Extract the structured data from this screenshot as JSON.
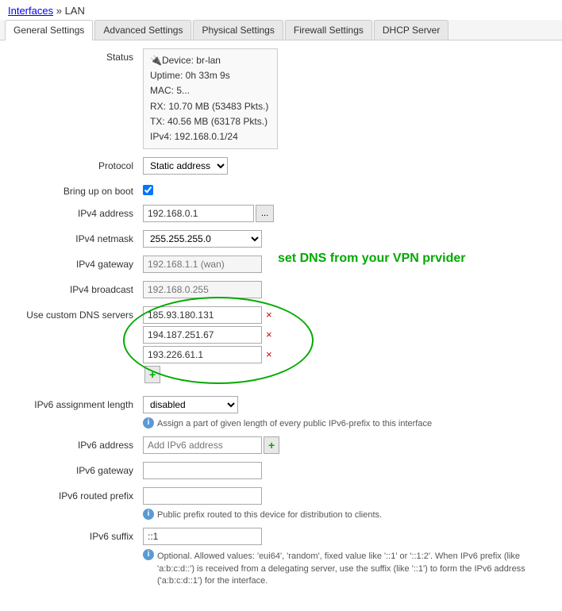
{
  "breadcrumb": {
    "parent": "Interfaces",
    "separator": " » ",
    "current": "LAN"
  },
  "tabs": [
    {
      "label": "General Settings",
      "active": true
    },
    {
      "label": "Advanced Settings",
      "active": false
    },
    {
      "label": "Physical Settings",
      "active": false
    },
    {
      "label": "Firewall Settings",
      "active": false
    },
    {
      "label": "DHCP Server",
      "active": false
    }
  ],
  "fields": {
    "status_label": "Status",
    "status_device": "Device: br-lan",
    "status_uptime": "Uptime: 0h 33m 9s",
    "status_mac": "MAC: 5...",
    "status_rx": "RX: 10.70 MB (53483 Pkts.)",
    "status_tx": "TX: 40.56 MB (63178 Pkts.)",
    "status_ipv4": "IPv4: 192.168.0.1/24",
    "protocol_label": "Protocol",
    "protocol_value": "Static address",
    "bring_up_label": "Bring up on boot",
    "ipv4_address_label": "IPv4 address",
    "ipv4_address_value": "192.168.0.1",
    "ipv4_netmask_label": "IPv4 netmask",
    "ipv4_netmask_value": "255.255.255.0",
    "ipv4_gateway_label": "IPv4 gateway",
    "ipv4_gateway_placeholder": "192.168.1.1 (wan)",
    "ipv4_broadcast_label": "IPv4 broadcast",
    "ipv4_broadcast_placeholder": "192.168.0.255",
    "custom_dns_label": "Use custom DNS servers",
    "dns1": "185.93.180.131",
    "dns2": "194.187.251.67",
    "dns3": "193.226.61.1",
    "vpn_note": "set DNS from your VPN prvider",
    "ipv6_assignment_label": "IPv6 assignment length",
    "ipv6_assignment_value": "disabled",
    "ipv6_assignment_help": "Assign a part of given length of every public IPv6-prefix to this interface",
    "ipv6_address_label": "IPv6 address",
    "ipv6_address_placeholder": "Add IPv6 address",
    "ipv6_gateway_label": "IPv6 gateway",
    "ipv6_routed_label": "IPv6 routed prefix",
    "ipv6_routed_help": "Public prefix routed to this device for distribution to clients.",
    "ipv6_suffix_label": "IPv6 suffix",
    "ipv6_suffix_value": "::1",
    "ipv6_suffix_help": "Optional. Allowed values: 'eui64', 'random', fixed value like '::1' or '::1:2'. When IPv6 prefix (like 'a:b:c:d::') is received from a delegating server, use the suffix (like '::1') to form the IPv6 address ('a:b:c:d::1') for the interface.",
    "dots_btn": "...",
    "plus_symbol": "+",
    "remove_symbol": "×"
  }
}
